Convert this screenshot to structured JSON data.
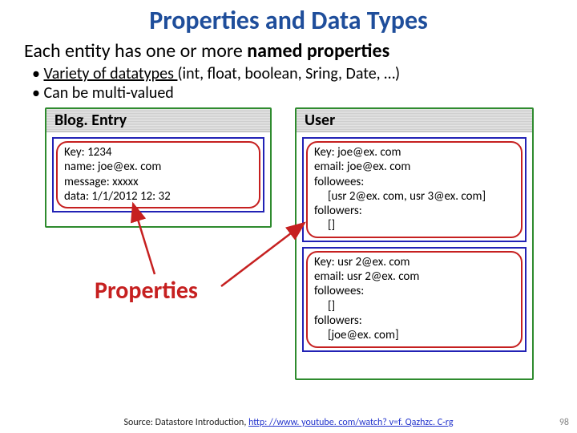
{
  "title": "Properties and Data Types",
  "subtitle_pre": "Each entity has one or more ",
  "subtitle_bold": "named properties",
  "bullets": {
    "b1_u": "Variety of datatypes ",
    "b1_rest": "(int, float, boolean, Sring, Date, …)",
    "b2": "Can be multi-valued"
  },
  "blog": {
    "header": "Blog. Entry",
    "l1": "Key: 1234",
    "l2": "name: joe@ex. com",
    "l3": "message: xxxxx",
    "l4": "data: 1/1/2012 12: 32"
  },
  "user": {
    "header": "User",
    "r1": {
      "l1": "Key: joe@ex. com",
      "l2": "email: joe@ex. com",
      "l3": "followees:",
      "l4": "     [usr 2@ex. com, usr 3@ex. com]",
      "l5": "followers:",
      "l6": "     []"
    },
    "r2": {
      "l1": "Key: usr 2@ex. com",
      "l2": "email: usr 2@ex. com",
      "l3": "followees:",
      "l4": "     []",
      "l5": "followers:",
      "l6": "     [joe@ex. com]"
    }
  },
  "props_label": "Properties",
  "footer": {
    "pre": "Source: Datastore Introduction, ",
    "link": "http: //www. youtube. com/watch? v=f. Qazhzc. C-rg"
  },
  "pagenum": "98"
}
